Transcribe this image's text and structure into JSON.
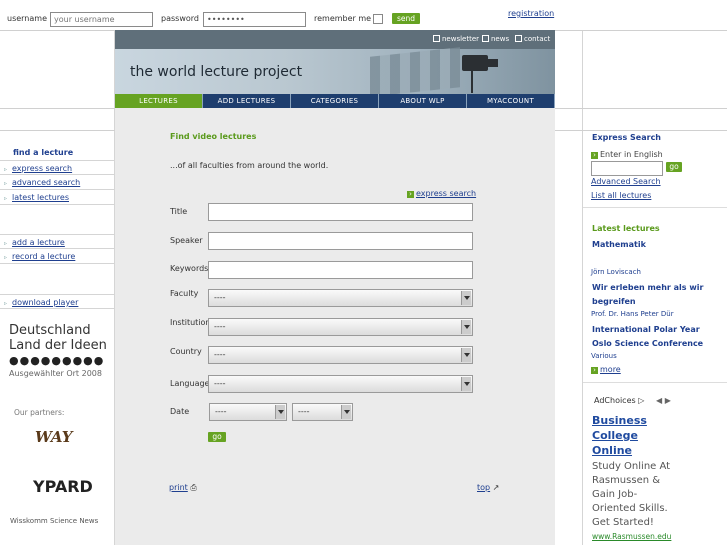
{
  "top": {
    "username_label": "username",
    "username_placeholder": "your username",
    "password_label": "password",
    "password_value": "••••••••",
    "remember_label": "remember me",
    "send_label": "send",
    "registration": "registration"
  },
  "banner": {
    "title": "the world lecture project",
    "links": [
      "newsletter",
      "news",
      "contact"
    ]
  },
  "nav": [
    "LECTURES",
    "ADD LECTURES",
    "CATEGORIES",
    "ABOUT WLP",
    "MYACCOUNT"
  ],
  "left": {
    "heading": "find a lecture",
    "items": [
      "express search",
      "advanced search",
      "latest lectures"
    ],
    "items2": [
      "add a lecture",
      "record a lecture"
    ],
    "items3": [
      "download player"
    ],
    "logo_line1": "Deutschland",
    "logo_line2": "Land der Ideen",
    "logo_line3": "Ausgewählter Ort 2008",
    "partners": "Our partners:",
    "partner1": "WAY",
    "partner2": "YPARD",
    "footer": "Wisskomm Science News"
  },
  "main": {
    "title": "Find video lectures",
    "subtitle": "...of all faculties from around the world.",
    "express_link": "express search",
    "labels": {
      "title": "Title",
      "speaker": "Speaker",
      "keywords": "Keywords",
      "faculty": "Faculty",
      "institution": "Institution",
      "country": "Country",
      "language": "Language",
      "date": "Date"
    },
    "select_default": "----",
    "go": "go",
    "print": "print",
    "top": "top"
  },
  "right": {
    "express_heading": "Express Search",
    "enter_label": "Enter in English",
    "go": "go",
    "advanced": "Advanced Search",
    "list_all": "List all lectures",
    "latest_heading": "Latest lectures",
    "lecture1_title": "Mathematik",
    "lecture1_speaker": "Jörn Loviscach",
    "lecture2_title": "Wir erleben mehr als wir begreifen",
    "lecture2_speaker": "Prof. Dr. Hans Peter Dür",
    "lecture3_title": "International Polar Year Oslo Science Conference",
    "lecture3_speaker": "Various",
    "more": "more"
  },
  "ad": {
    "adchoices": "AdChoices",
    "title": "Business College Online",
    "body": "Study Online At Rasmussen & Gain Job-Oriented Skills. Get Started!",
    "url": "www.Rasmussen.edu"
  }
}
